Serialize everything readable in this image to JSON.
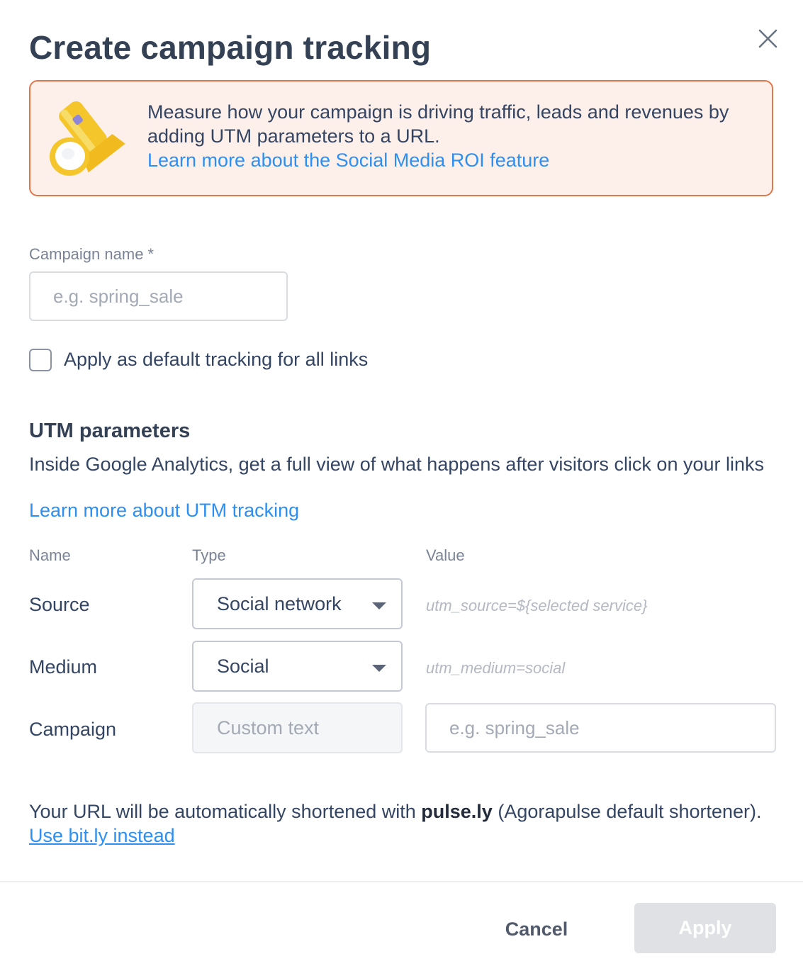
{
  "dialog": {
    "title": "Create campaign tracking",
    "close_icon": "close-icon"
  },
  "banner": {
    "illustration": "flashlight-icon",
    "text": "Measure how your campaign is driving traffic, leads and revenues by adding UTM parameters to a URL.",
    "link": "Learn more about the Social Media ROI feature"
  },
  "campaign": {
    "label": "Campaign name *",
    "placeholder": "e.g. spring_sale",
    "value": ""
  },
  "default_tracking": {
    "label": "Apply as default tracking for all links",
    "checked": false
  },
  "utm": {
    "heading": "UTM parameters",
    "description": "Inside Google Analytics, get a full view of what happens after visitors click on your links",
    "link": "Learn more about UTM tracking",
    "columns": {
      "name": "Name",
      "type": "Type",
      "value": "Value"
    },
    "rows": [
      {
        "name": "Source",
        "type": "Social network",
        "value": "utm_source=${selected service}"
      },
      {
        "name": "Medium",
        "type": "Social",
        "value": "utm_medium=social"
      },
      {
        "name": "Campaign",
        "type": "Custom text",
        "value_placeholder": "e.g. spring_sale"
      }
    ]
  },
  "shortener": {
    "text_before": "Your URL will be automatically shortened with ",
    "service": "pulse.ly",
    "text_after": " (Agorapulse default shortener). ",
    "link": "Use bit.ly instead"
  },
  "footer": {
    "cancel_label": "Cancel",
    "apply_label": "Apply",
    "apply_enabled": false
  },
  "colors": {
    "accent": "#2d8ff2",
    "banner_border": "#e0774c",
    "banner_bg": "#fdefea",
    "apply_disabled_bg": "#dfe1e5"
  }
}
